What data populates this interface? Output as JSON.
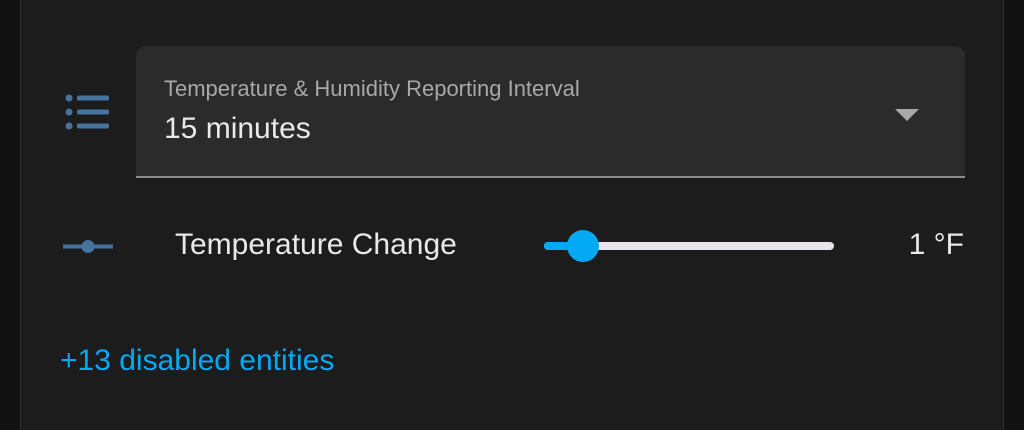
{
  "colors": {
    "background": "#111111",
    "card": "#1c1c1c",
    "field": "#2b2b2b",
    "accent": "#03a9f4",
    "icon": "#44739e",
    "text_primary": "#e9e9e9",
    "text_secondary": "#a8a8a8"
  },
  "select_row": {
    "icon": "format-list-bulleted-icon",
    "label": "Temperature & Humidity Reporting Interval",
    "value": "15 minutes"
  },
  "slider_row": {
    "icon": "ray-vertex-icon",
    "name": "Temperature Change",
    "value_text": "1 °F",
    "level_fraction": 0.135
  },
  "footer": {
    "disabled_entities_label": "+13 disabled entities"
  }
}
